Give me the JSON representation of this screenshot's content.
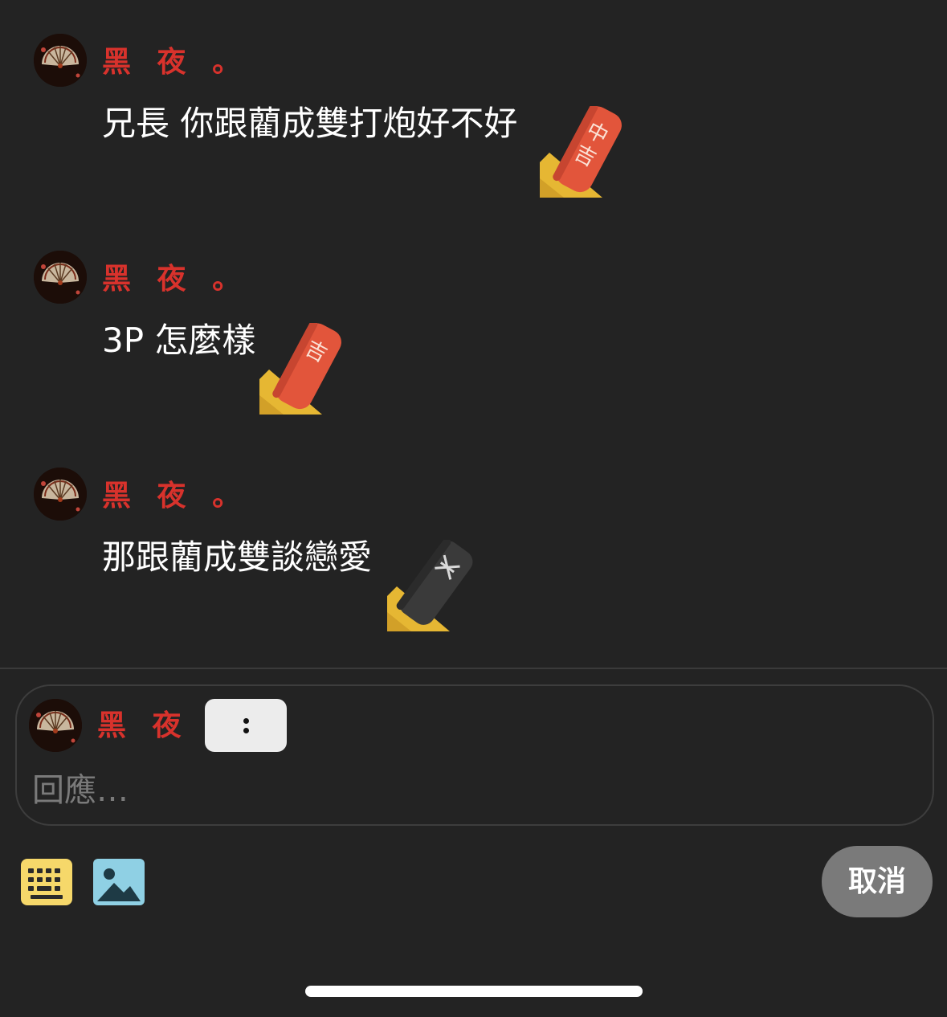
{
  "messages": [
    {
      "username": "黑 夜 。",
      "text": "兄長 你跟藺成雙打炮好不好",
      "sticker": "mahjong-tile-red-zhong-sticker"
    },
    {
      "username": "黑 夜 。",
      "text": "3P 怎麼樣",
      "sticker": "mahjong-tile-red-sticker"
    },
    {
      "username": "黑 夜 。",
      "text": "那跟藺成雙談戀愛",
      "sticker": "mahjong-tile-black-sticker"
    }
  ],
  "reply": {
    "username": "黑 夜 。",
    "placeholder": "回應…",
    "options_icon": "more-vertical-icon"
  },
  "toolbar": {
    "keyboard_icon": "keyboard-icon",
    "image_icon": "image-icon",
    "cancel_label": "取消"
  },
  "colors": {
    "background": "#232323",
    "username": "#d8322c",
    "text": "#ffffff",
    "placeholder": "#7a7a7a",
    "cancel_bg": "#7a7a7a",
    "keyboard_icon": "#f6d86a",
    "image_icon": "#8fd0e4"
  }
}
